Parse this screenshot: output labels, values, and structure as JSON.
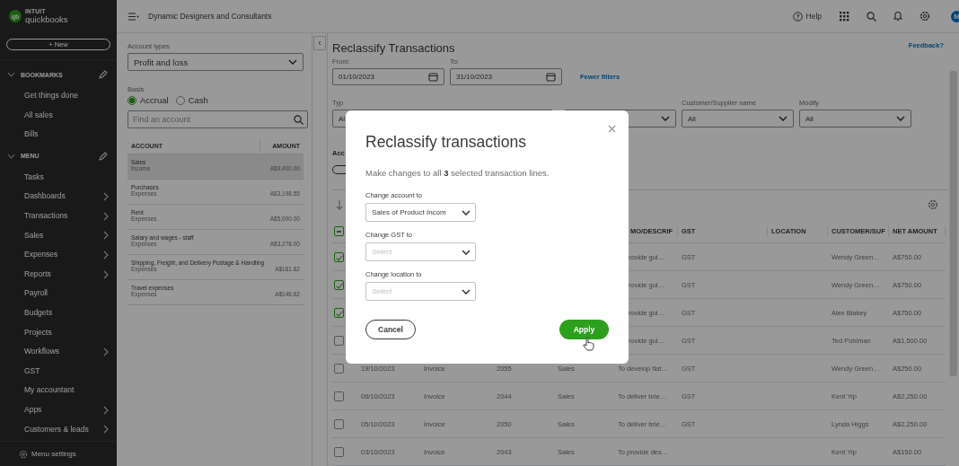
{
  "sidebar": {
    "logo": {
      "mark": "qb",
      "maker": "INTUIT",
      "product": "quickbooks"
    },
    "new_button": "+ New",
    "sections": [
      {
        "title": "BOOKMARKS",
        "items": [
          {
            "label": "Get things done",
            "submenu": false
          },
          {
            "label": "All sales",
            "submenu": false
          },
          {
            "label": "Bills",
            "submenu": false
          }
        ]
      },
      {
        "title": "MENU",
        "items": [
          {
            "label": "Tasks",
            "submenu": false
          },
          {
            "label": "Dashboards",
            "submenu": true
          },
          {
            "label": "Transactions",
            "submenu": true
          },
          {
            "label": "Sales",
            "submenu": true
          },
          {
            "label": "Expenses",
            "submenu": true
          },
          {
            "label": "Reports",
            "submenu": true
          },
          {
            "label": "Payroll",
            "submenu": false
          },
          {
            "label": "Budgets",
            "submenu": false
          },
          {
            "label": "Projects",
            "submenu": false
          },
          {
            "label": "Workflows",
            "submenu": true
          },
          {
            "label": "GST",
            "submenu": false
          },
          {
            "label": "My accountant",
            "submenu": false
          },
          {
            "label": "Apps",
            "submenu": true
          },
          {
            "label": "Customers & leads",
            "submenu": true
          }
        ]
      }
    ],
    "footer": "Menu settings"
  },
  "topbar": {
    "company": "Dynamic Designers and Consultants",
    "help": "Help",
    "avatar": "M"
  },
  "account_panel": {
    "account_types_label": "Account types",
    "account_type": "Profit and loss",
    "basis_label": "Basis",
    "basis_options": [
      {
        "label": "Accrual",
        "selected": true
      },
      {
        "label": "Cash",
        "selected": false
      }
    ],
    "search": {
      "placeholder": "Find an account"
    },
    "columns": [
      "ACCOUNT",
      "AMOUNT"
    ],
    "accounts": [
      {
        "name": "Sales",
        "type": "Income",
        "amount": "A$9,400.00",
        "selected": true
      },
      {
        "name": "Purchases",
        "type": "Expenses",
        "amount": "A$3,198.55",
        "selected": false
      },
      {
        "name": "Rent",
        "type": "Expenses",
        "amount": "A$5,000.00",
        "selected": false
      },
      {
        "name": "Salary and wages - staff",
        "type": "Expenses",
        "amount": "A$3,278.00",
        "selected": false
      },
      {
        "name": "Shipping, Freight, and Delivery Postage & Handling",
        "type": "Expenses",
        "amount": "A$181.82",
        "selected": false
      },
      {
        "name": "Travel expenses",
        "type": "Expenses",
        "amount": "A$146.62",
        "selected": false
      }
    ]
  },
  "page": {
    "title": "Reclassify Transactions",
    "feedback": "Feedback?",
    "dates": [
      {
        "label": "From:",
        "value": "01/10/2023"
      },
      {
        "label": "To:",
        "value": "31/10/2023"
      }
    ],
    "fewer_filters": "Fewer filters",
    "first_filter": {
      "label": "Typ",
      "value": "Al"
    },
    "filters": [
      {
        "label": "Customer/Supplier name",
        "value": "All"
      },
      {
        "label": "Modify",
        "value": "All"
      }
    ],
    "accounts_label": "Acc",
    "table": {
      "select_all_partial": true,
      "columns": {
        "memo": "MO/DESCRIF",
        "gst": "GST",
        "location": "LOCATION",
        "customer": "CUSTOMER/SUF",
        "amount": "NET AMOUNT"
      },
      "rows": [
        {
          "checked": true,
          "memo": "rovide gui…",
          "gst": "GST",
          "customer": "Wendy Green…",
          "amount": "A$750.00"
        },
        {
          "checked": true,
          "memo": "rovide gui…",
          "gst": "GST",
          "customer": "Wendy Green…",
          "amount": "A$750.00"
        },
        {
          "checked": true,
          "memo": "rovide gui…",
          "gst": "GST",
          "customer": "Alex Blakey",
          "amount": "A$750.00"
        },
        {
          "checked": false,
          "memo": "rovide gui…",
          "gst": "GST",
          "customer": "Ted Pohlman",
          "amount": "A$1,500.00"
        },
        {
          "checked": false,
          "date": "19/10/2023",
          "type": "Invoice",
          "number": "2055",
          "account": "Sales",
          "memo": "To develop flat…",
          "gst": "GST",
          "customer": "Wendy Green…",
          "amount": "A$250.00"
        },
        {
          "checked": false,
          "date": "06/10/2023",
          "type": "Invoice",
          "number": "2044",
          "account": "Sales",
          "memo": "To deliver brie…",
          "gst": "GST",
          "customer": "Kent Yip",
          "amount": "A$2,250.00"
        },
        {
          "checked": false,
          "date": "05/10/2023",
          "type": "Invoice",
          "number": "2050",
          "account": "Sales",
          "memo": "To deliver brie…",
          "gst": "GST",
          "customer": "Lynda Higgs",
          "amount": "A$2,250.00"
        },
        {
          "checked": false,
          "date": "03/10/2023",
          "type": "Invoice",
          "number": "2043",
          "account": "Sales",
          "memo": "To provide des…",
          "customer": "Kent Yip",
          "amount": "A$150.00"
        }
      ]
    }
  },
  "modal": {
    "title": "Reclassify transactions",
    "message": "Make changes to all **3** selected transaction lines.",
    "fields": [
      {
        "label": "Change account to",
        "value": "Sales of Product Incom"
      },
      {
        "label": "Change GST to",
        "placeholder": "Select"
      },
      {
        "label": "Change location to",
        "placeholder": "Select"
      }
    ],
    "cancel": "Cancel",
    "apply": "Apply"
  }
}
